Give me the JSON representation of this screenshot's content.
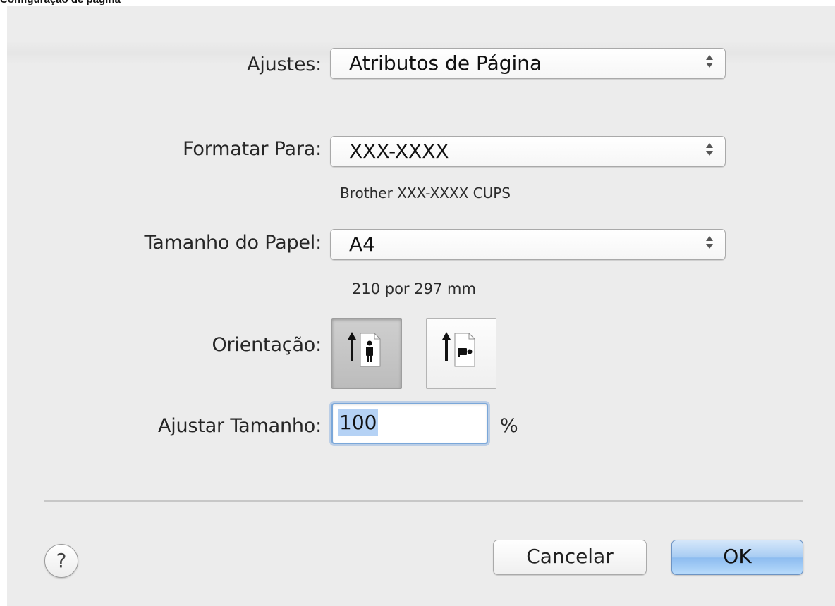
{
  "page_caption": "Configuração de página",
  "settings": {
    "label": "Ajustes:",
    "value": "Atributos de Página"
  },
  "format_for": {
    "label": "Formatar Para:",
    "value": "XXX-XXXX",
    "description": "Brother XXX-XXXX CUPS"
  },
  "paper_size": {
    "label": "Tamanho do Papel:",
    "value": "A4",
    "description": "210 por 297 mm"
  },
  "orientation": {
    "label": "Orientação:",
    "options": [
      {
        "name": "portrait",
        "selected": true
      },
      {
        "name": "landscape",
        "selected": false
      }
    ]
  },
  "scale": {
    "label": "Ajustar Tamanho:",
    "value": "100",
    "unit": "%"
  },
  "buttons": {
    "help": "?",
    "cancel": "Cancelar",
    "ok": "OK"
  },
  "icons": [
    "up-down-arrows-icon",
    "portrait-orientation-icon",
    "landscape-orientation-icon",
    "help-icon"
  ]
}
